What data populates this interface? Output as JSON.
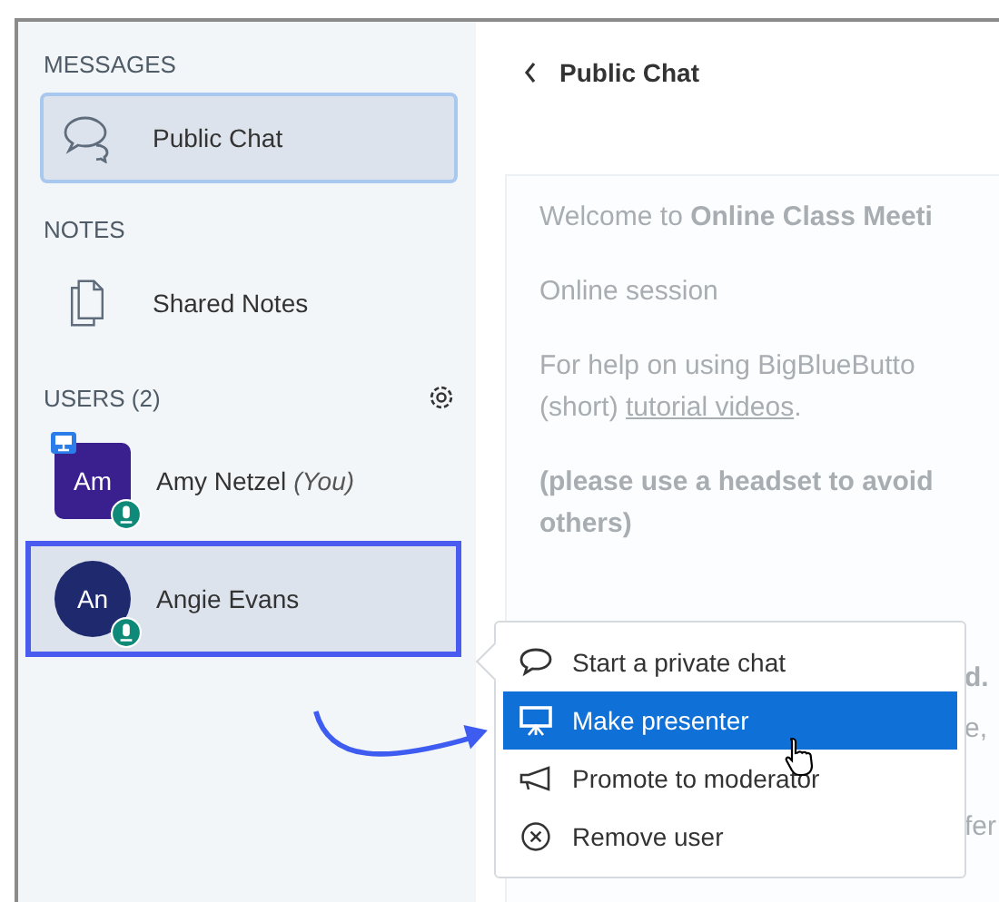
{
  "sidebar": {
    "sections": [
      {
        "title": "MESSAGES",
        "items": [
          {
            "kind": "chat",
            "label": "Public Chat",
            "selected": true
          }
        ]
      },
      {
        "title": "NOTES",
        "items": [
          {
            "kind": "notes",
            "label": "Shared Notes",
            "selected": false
          }
        ]
      }
    ],
    "users_title": "USERS (2)",
    "users": [
      {
        "initials": "Am",
        "name": "Amy Netzel",
        "suffix": "(You)",
        "color": "#3a1f8f",
        "kind": "square",
        "presenter": true,
        "selected": false
      },
      {
        "initials": "An",
        "name": "Angie Evans",
        "color": "#1f2a6e",
        "kind": "round",
        "presenter": false,
        "selected": true
      }
    ]
  },
  "chat": {
    "title": "Public Chat",
    "paragraphs": [
      "Welcome to **Online Class Meeti**",
      "Online session",
      "For help on using BigBlueButto",
      "(please use a headset to avoid"
    ],
    "help_line_2": "(short) ",
    "link": "tutorial videos",
    "link_after": ".",
    "bold_line_2": "others)",
    "fragments": [
      "d.",
      "e,",
      "fer"
    ]
  },
  "menu": {
    "items": [
      {
        "kind": "chat",
        "label": "Start a private chat",
        "selected": false
      },
      {
        "kind": "presenter",
        "label": "Make presenter",
        "selected": true
      },
      {
        "kind": "promote",
        "label": "Promote to moderator",
        "selected": false
      },
      {
        "kind": "remove",
        "label": "Remove user",
        "selected": false
      }
    ]
  }
}
